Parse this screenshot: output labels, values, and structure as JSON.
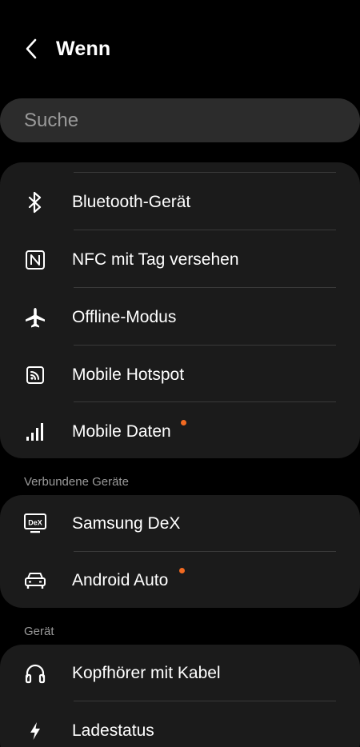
{
  "header": {
    "title": "Wenn"
  },
  "search": {
    "placeholder": "Suche"
  },
  "connections": {
    "items": [
      {
        "label": "Bluetooth-Gerät",
        "icon": "bluetooth-icon"
      },
      {
        "label": "NFC mit Tag versehen",
        "icon": "nfc-icon"
      },
      {
        "label": "Offline-Modus",
        "icon": "airplane-icon"
      },
      {
        "label": "Mobile Hotspot",
        "icon": "hotspot-icon"
      },
      {
        "label": "Mobile Daten",
        "icon": "signal-bars-icon",
        "badge": true
      }
    ]
  },
  "connected_devices": {
    "header": "Verbundene Geräte",
    "items": [
      {
        "label": "Samsung DeX",
        "icon": "dex-icon",
        "icon_text": "DeX"
      },
      {
        "label": "Android Auto",
        "icon": "car-icon",
        "badge": true
      }
    ]
  },
  "device": {
    "header": "Gerät",
    "items": [
      {
        "label": "Kopfhörer mit Kabel",
        "icon": "headphones-icon"
      },
      {
        "label": "Ladestatus",
        "icon": "lightning-icon"
      }
    ]
  },
  "colors": {
    "background": "#000000",
    "card": "#1b1b1b",
    "search": "#2c2c2c",
    "badge": "#f26a21",
    "secondary_text": "#9a9a9a"
  }
}
